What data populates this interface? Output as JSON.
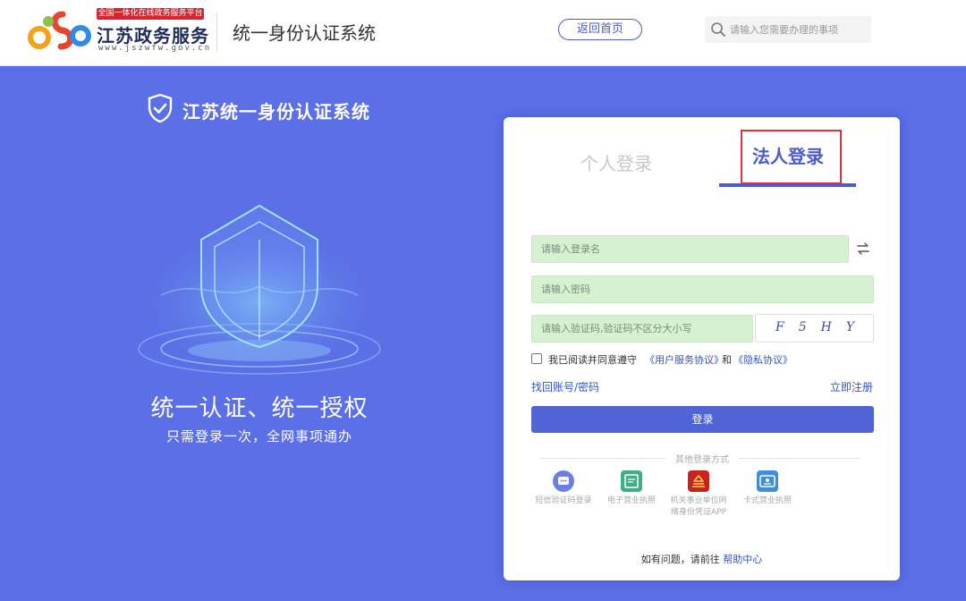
{
  "header": {
    "logo_tag": "全国一体化在线政务服务平台",
    "logo_title": "江苏政务服务",
    "logo_url": "www.jszwfw.gov.cn",
    "system_title": "统一身份认证系统",
    "home_button": "返回首页",
    "search_placeholder": "请输入您需要办理的事项"
  },
  "hero": {
    "system_name": "江苏统一身份认证系统",
    "slogan": "统一认证、统一授权",
    "subtitle": "只需登录一次，全网事项通办"
  },
  "login": {
    "tabs": [
      {
        "label": "个人登录",
        "active": false
      },
      {
        "label": "法人登录",
        "active": true
      }
    ],
    "username_placeholder": "请输入登录名",
    "password_placeholder": "请输入密码",
    "captcha_placeholder": "请输入验证码,验证码不区分大小写",
    "captcha_text": "F5HY",
    "agree_text": "我已阅读并同意遵守",
    "agree_link_1": "《用户服务协议》",
    "agree_and": "和",
    "agree_link_2": "《隐私协议》",
    "forgot": "找回账号/密码",
    "register": "立即注册",
    "login_button": "登录",
    "other_title": "其他登录方式",
    "methods": [
      {
        "label": "短信验证码登录",
        "icon": "sms-icon",
        "color": "#6b7fe3"
      },
      {
        "label": "电子营业执照",
        "icon": "e-license-icon",
        "color": "#3fae86"
      },
      {
        "label": "机关事业单位网",
        "label2": "络身份凭证APP",
        "icon": "gov-app-icon",
        "color": "#c9231e"
      },
      {
        "label": "卡式营业执照",
        "icon": "card-license-icon",
        "color": "#3f8fd8"
      }
    ],
    "help_text": "如有问题，请前往",
    "help_link": "帮助中心"
  },
  "colors": {
    "accent": "#4a5bd1",
    "background": "#5b6fe6",
    "highlight": "#e0313c"
  }
}
